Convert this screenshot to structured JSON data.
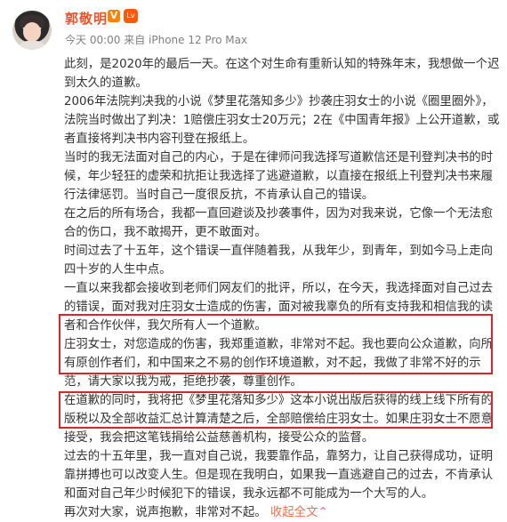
{
  "post": {
    "author": "郭敬明",
    "verified_badge": "V",
    "level_badge": "Lv",
    "meta": "今天 00:00 来自 iPhone 12 Pro Max",
    "paragraphs": [
      "此刻，是2020年的最后一天。在这个对生命有重新认知的特殊年末，我想做一个迟到太久的道歉。",
      "2006年法院判决我的小说《梦里花落知多少》抄袭庄羽女士的小说《圈里圈外》，法院当时做出了判决：1赔偿庄羽女士20万元；2在《中国青年报》上公开道歉，或者直接将判决书内容刊登在报纸上。",
      "当时的我无法面对自己的内心，于是在律师问我选择写道歉信还是刊登判决书的时候，年少轻狂的虚荣和抗拒让我选择了逃避道歉，以直接在报纸上刊登判决书来履行法律惩罚。当时自己一度很反抗，不肯承认自己的错误。",
      "在之后的所有场合，我都一直回避谈及抄袭事件，因为对我来说，它像一个无法愈合的伤口，我不敢揭开，更不敢面对。",
      "时间过去了十五年，这个错误一直伴随着我，从我年少，到青年，到如今马上走向四十岁的人生中点。",
      "一直以来我都会接收到老师们网友们的批评，所以，在今天，我选择面对自己过去的错误，面对我对庄羽女士造成的伤害，面对被我辜负的所有支持我和相信我的读者和合作伙伴，我欠所有人一个道歉。",
      "庄羽女士，对您造成的伤害，我郑重道歉，非常对不起。我也要向公众道歉，向所有原创作者们，和中国来之不易的创作环境道歉，对不起，我做了非常不好的示范，请大家以我为戒，拒绝抄袭，尊重创作。",
      "在道歉的同时，我将把《梦里花落知多少》这本小说出版后获得的线上线下所有的版税以及全部收益汇总计算清楚之后，全部赔偿给庄羽女士。如果庄羽女士不愿意接受，我会把这笔钱捐给公益慈善机构，接受公众的监督。",
      "过去的十五年里，我一直对自己说，我要靠作品，靠努力，让自己获得成功，证明靠拼搏也可以改变人生。但是现在我明白，如果我一直逃避自己的过去，不肯承认和面对自己年少时候犯下的错误，我永远都不可能成为一个大写的人。",
      "再次对大家，说声抱歉，非常对不起。"
    ],
    "collapse_link": "收起全文",
    "collapse_icon": "chevron-up-icon"
  }
}
